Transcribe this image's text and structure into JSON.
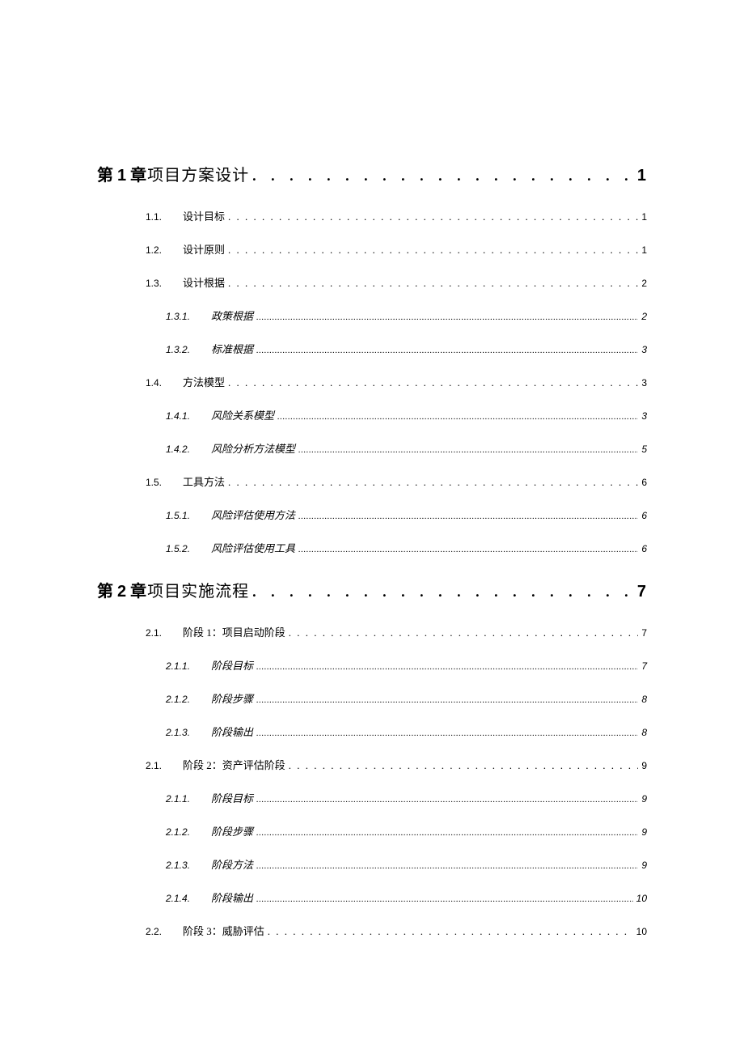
{
  "toc": [
    {
      "level": "chapter",
      "prefix": "第",
      "num": "1",
      "suffix": "章",
      "title": "项目方案设计",
      "page": "1"
    },
    {
      "level": "section",
      "num": "1.1.",
      "title": "设计目标",
      "page": "1"
    },
    {
      "level": "section",
      "num": "1.2.",
      "title": "设计原则",
      "page": "1"
    },
    {
      "level": "section",
      "num": "1.3.",
      "title": "设计根据",
      "page": "2"
    },
    {
      "level": "subsection",
      "num": "1.3.1.",
      "title": "政策根据",
      "page": "2"
    },
    {
      "level": "subsection",
      "num": "1.3.2.",
      "title": "标准根据",
      "page": "3"
    },
    {
      "level": "section",
      "num": "1.4.",
      "title": "方法模型",
      "page": "3"
    },
    {
      "level": "subsection",
      "num": "1.4.1.",
      "title": "风险关系模型",
      "page": "3"
    },
    {
      "level": "subsection",
      "num": "1.4.2.",
      "title": "风险分析方法模型",
      "page": "5"
    },
    {
      "level": "section",
      "num": "1.5.",
      "title": "工具方法",
      "page": "6"
    },
    {
      "level": "subsection",
      "num": "1.5.1.",
      "title": "风险评估使用方法",
      "page": "6"
    },
    {
      "level": "subsection",
      "num": "1.5.2.",
      "title": "风险评估使用工具",
      "page": "6"
    },
    {
      "level": "chapter",
      "prefix": "第",
      "num": "2",
      "suffix": "章",
      "title": "项目实施流程",
      "page": "7"
    },
    {
      "level": "section",
      "num": "2.1.",
      "title": "阶段 1：项目启动阶段",
      "page": "7"
    },
    {
      "level": "subsection",
      "num": "2.1.1.",
      "title": "阶段目标",
      "page": "7"
    },
    {
      "level": "subsection",
      "num": "2.1.2.",
      "title": "阶段步骤",
      "page": "8"
    },
    {
      "level": "subsection",
      "num": "2.1.3.",
      "title": "阶段输出",
      "page": "8"
    },
    {
      "level": "section",
      "num": "2.1.",
      "title": "阶段 2：资产评估阶段",
      "page": "9"
    },
    {
      "level": "subsection",
      "num": "2.1.1.",
      "title": "阶段目标",
      "page": "9"
    },
    {
      "level": "subsection",
      "num": "2.1.2.",
      "title": "阶段步骤",
      "page": "9"
    },
    {
      "level": "subsection",
      "num": "2.1.3.",
      "title": "阶段方法",
      "page": "9"
    },
    {
      "level": "subsection",
      "num": "2.1.4.",
      "title": "阶段输出",
      "page": "10"
    },
    {
      "level": "section",
      "num": "2.2.",
      "title": "阶段 3：威胁评估",
      "page": "10"
    }
  ],
  "dots_chapter": ". . . . . . . . . . . . . . . . . . . . . . . . . . . . . . . . . . . . . . . . . . . . . . . . . . . . . . . . . . . . . . . . . .",
  "dots_section": ". . . . . . . . . . . . . . . . . . . . . . . . . . . . . . . . . . . . . . . . . . . . . . . . . . . . . . . . . . . . . . . . . . . . . . . . . . . . . . . . . . . . . . . . . . . . . . . . . . . . . . . . . . . . . . . . . . . . . . . . . . . . . . . . . . . .",
  "dots_subsection": "........................................................................................................................................................................................................................................................................................................................"
}
